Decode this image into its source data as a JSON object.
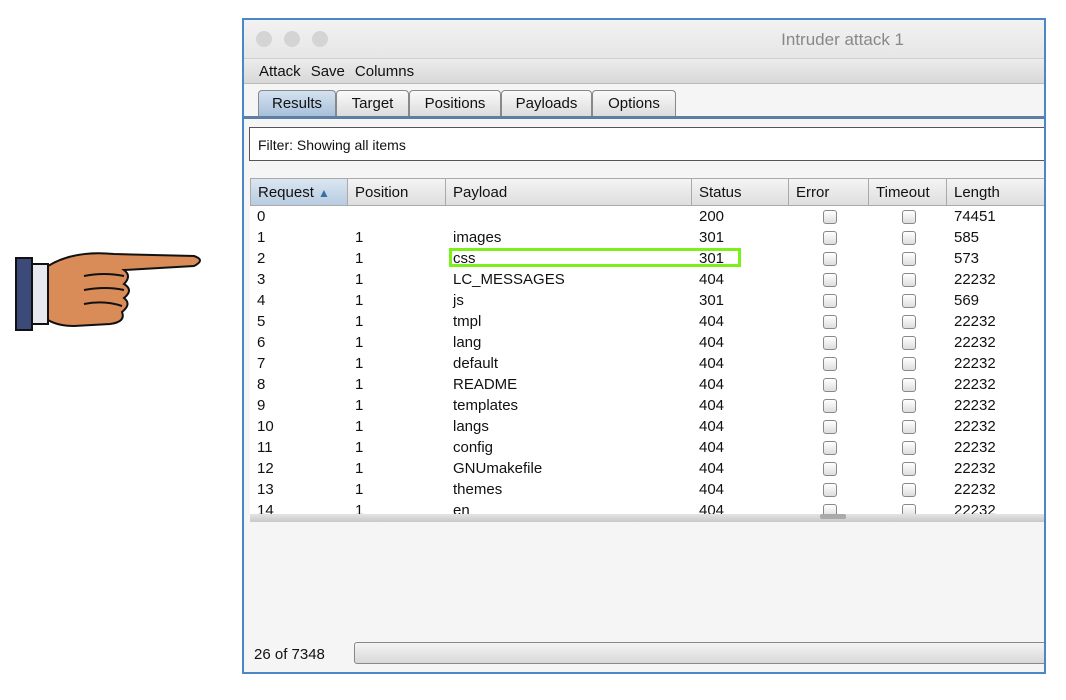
{
  "window": {
    "title": "Intruder attack 1"
  },
  "menu": [
    "Attack",
    "Save",
    "Columns"
  ],
  "tabs": [
    "Results",
    "Target",
    "Positions",
    "Payloads",
    "Options"
  ],
  "filter": "Filter: Showing all items",
  "columns": [
    "Request",
    "Position",
    "Payload",
    "Status",
    "Error",
    "Timeout",
    "Length"
  ],
  "sort_indicator": "▲",
  "rows": [
    [
      "0",
      "",
      "",
      "200",
      "74451"
    ],
    [
      "1",
      "1",
      "images",
      "301",
      "585"
    ],
    [
      "2",
      "1",
      "css",
      "301",
      "573"
    ],
    [
      "3",
      "1",
      "LC_MESSAGES",
      "404",
      "22232"
    ],
    [
      "4",
      "1",
      "js",
      "301",
      "569"
    ],
    [
      "5",
      "1",
      "tmpl",
      "404",
      "22232"
    ],
    [
      "6",
      "1",
      "lang",
      "404",
      "22232"
    ],
    [
      "7",
      "1",
      "default",
      "404",
      "22232"
    ],
    [
      "8",
      "1",
      "README",
      "404",
      "22232"
    ],
    [
      "9",
      "1",
      "templates",
      "404",
      "22232"
    ],
    [
      "10",
      "1",
      "langs",
      "404",
      "22232"
    ],
    [
      "11",
      "1",
      "config",
      "404",
      "22232"
    ],
    [
      "12",
      "1",
      "GNUmakefile",
      "404",
      "22232"
    ],
    [
      "13",
      "1",
      "themes",
      "404",
      "22232"
    ],
    [
      "14",
      "1",
      "en",
      "404",
      "22232"
    ]
  ],
  "highlight_color": "#7cf01a",
  "progress_text": "26 of 7348"
}
